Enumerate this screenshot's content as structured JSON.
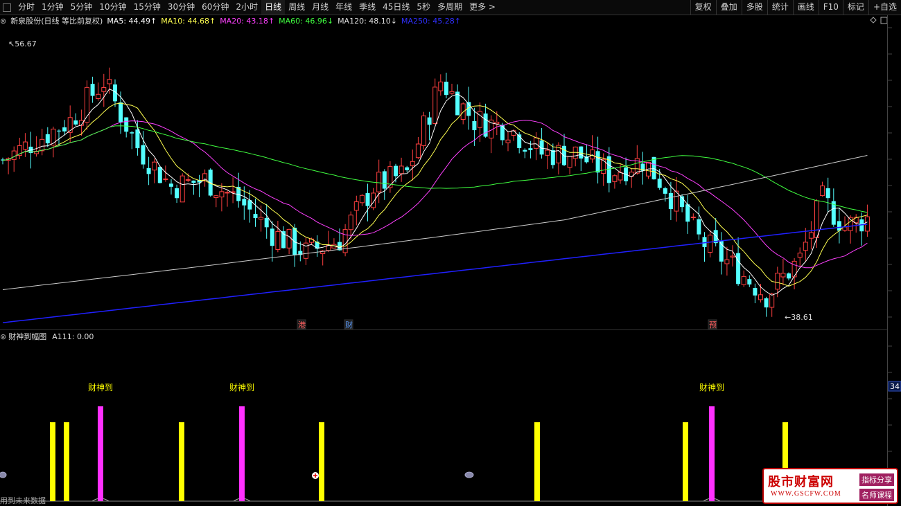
{
  "toolbar": {
    "left": [
      "分时",
      "1分钟",
      "5分钟",
      "10分钟",
      "15分钟",
      "30分钟",
      "60分钟",
      "2小时",
      "日线",
      "周线",
      "月线",
      "年线",
      "季线",
      "45日线",
      "5秒",
      "多周期",
      "更多 >"
    ],
    "active_index": 8,
    "right": [
      "复权",
      "叠加",
      "多股",
      "统计",
      "画线",
      "F10",
      "标记",
      "+自选"
    ]
  },
  "legend": {
    "title": "新泉股份(日线 等比前复权)",
    "ma": [
      {
        "label": "MA5: 44.49↑",
        "color": "#ffffff"
      },
      {
        "label": "MA10: 44.68↑",
        "color": "#ffff50"
      },
      {
        "label": "MA20: 43.18↑",
        "color": "#ff40ff"
      },
      {
        "label": "MA60: 46.96↓",
        "color": "#40ff40"
      },
      {
        "label": "MA120: 48.10↓",
        "color": "#dddddd"
      },
      {
        "label": "MA250: 45.28↑",
        "color": "#3030ff"
      }
    ]
  },
  "price_labels": {
    "high": "56.67",
    "low": "38.61"
  },
  "events": [
    "港",
    "财",
    "预"
  ],
  "sub_legend": {
    "title": "财神到幅图",
    "value": "A111: 0.00"
  },
  "signal_label": "财神到",
  "axis_tag": "34",
  "watermark": {
    "brand": "股市财富网",
    "url": "WWW.GSCFW.COM",
    "tag1": "指标分享",
    "tag2": "名师课程"
  },
  "footer_note": "用到未来数据",
  "colors": {
    "up": "#ff4040",
    "down": "#54ffff",
    "yellow_bar": "#ffff00",
    "magenta_bar": "#ff30ff"
  },
  "chart_data": {
    "type": "candlestick",
    "price_range": [
      36.5,
      58.5
    ],
    "yellow_signal_x": [
      76,
      96,
      262,
      464,
      775,
      989,
      1133
    ],
    "magenta_signal_x": [
      145,
      349,
      1027
    ],
    "signal_label_x": [
      145,
      349,
      1027
    ]
  }
}
